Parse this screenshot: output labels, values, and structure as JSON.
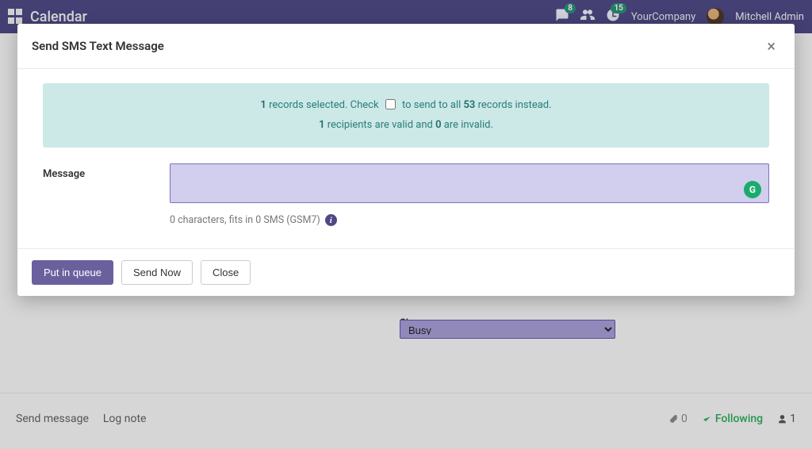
{
  "topbar": {
    "app_name": "Calendar",
    "badge_chat": "8",
    "badge_activity": "15",
    "company_name": "YourCompany",
    "user_name": "Mitchell Admin"
  },
  "modal": {
    "title": "Send SMS Text Message",
    "banner": {
      "selected_count": "1",
      "text_a": " records selected. Check ",
      "text_b": " to send to all  ",
      "total_count": "53",
      "text_c": " records instead.",
      "valid_count": "1",
      "text_d": " recipients are valid and ",
      "invalid_count": "0",
      "text_e": " are invalid."
    },
    "message_label": "Message",
    "message_value": "",
    "char_info": "0 characters, fits in 0 SMS (GSM7)",
    "buttons": {
      "put_in_queue": "Put in queue",
      "send_now": "Send Now",
      "close": "Close"
    }
  },
  "background": {
    "show_as_label": "Show as",
    "show_as_value": "Busy",
    "send_message": "Send message",
    "log_note": "Log note",
    "attach_count": "0",
    "following": "Following",
    "followers": "1"
  }
}
